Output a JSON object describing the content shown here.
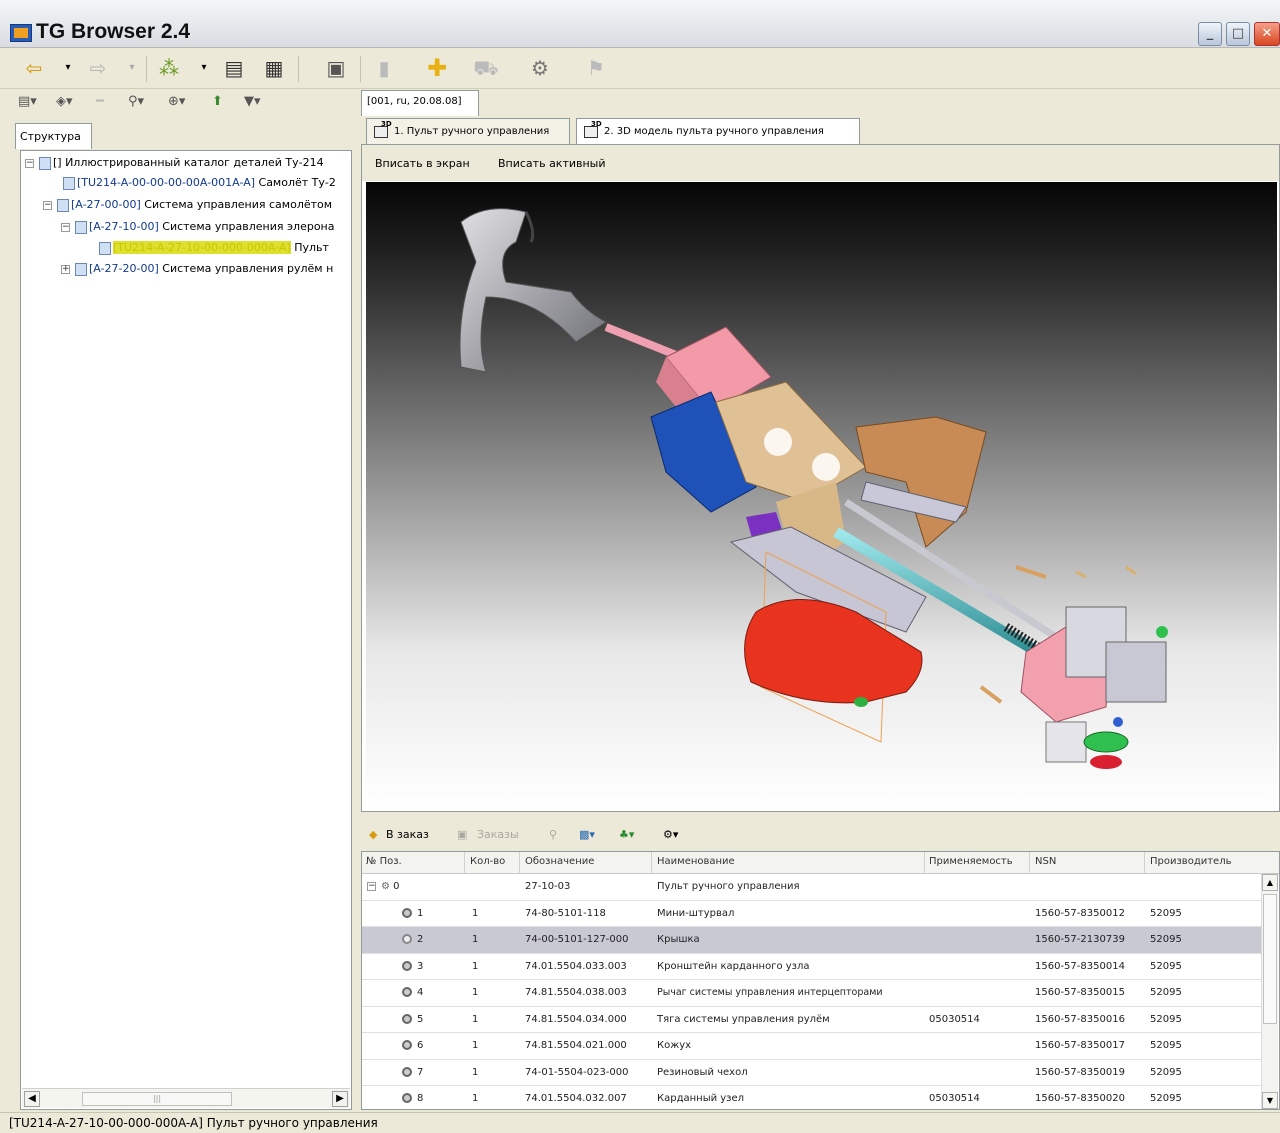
{
  "window": {
    "title": "TG Browser 2.4",
    "min_label": "_",
    "max_label": "□",
    "close_label": "✕"
  },
  "left": {
    "tab_label": "Структура",
    "tree": [
      {
        "code": "",
        "text": "[] Иллюстрированный каталог деталей Ту-214"
      },
      {
        "code": "[TU214-A-00-00-00-00A-001A-A]",
        "text": " Самолёт Ту-2"
      },
      {
        "code": "[A-27-00-00]",
        "text": " Система управления самолётом"
      },
      {
        "code": "[A-27-10-00]",
        "text": " Система управления элерона"
      },
      {
        "code": "[TU214-A-27-10-00-000-000A-A]",
        "text": " Пульт"
      },
      {
        "code": "[A-27-20-00]",
        "text": " Система управления рулём н"
      }
    ]
  },
  "doc_tab": "[001, ru, 20.08.08]",
  "view_tabs": [
    "1. Пульт ручного управления",
    "2. 3D модель пульта ручного управления"
  ],
  "fit_bar": {
    "fit_screen": "Вписать в экран",
    "fit_active": "Вписать активный"
  },
  "bottom_toolbar": {
    "add_to_order": "В заказ",
    "orders": "Заказы"
  },
  "grid": {
    "headers": [
      "№ Поз.",
      "Кол-во",
      "Обозначение",
      "Наименование",
      "Применяемость",
      "NSN",
      "Производитель"
    ],
    "rows": [
      {
        "pos": "0",
        "qty": "",
        "designation": "27-10-03",
        "name": "Пульт ручного управления",
        "applicability": "",
        "nsn": "",
        "manufacturer": ""
      },
      {
        "pos": "1",
        "qty": "1",
        "designation": "74-80-5101-118",
        "name": "Мини-штурвал",
        "applicability": "",
        "nsn": "1560-57-8350012",
        "manufacturer": "52095"
      },
      {
        "pos": "2",
        "qty": "1",
        "designation": "74-00-5101-127-000",
        "name": "Крышка",
        "applicability": "",
        "nsn": "1560-57-2130739",
        "manufacturer": "52095"
      },
      {
        "pos": "3",
        "qty": "1",
        "designation": "74.01.5504.033.003",
        "name": "Кронштейн карданного узла",
        "applicability": "",
        "nsn": "1560-57-8350014",
        "manufacturer": "52095"
      },
      {
        "pos": "4",
        "qty": "1",
        "designation": "74.81.5504.038.003",
        "name": "Рычаг системы управления интерцепторами",
        "applicability": "",
        "nsn": "1560-57-8350015",
        "manufacturer": "52095"
      },
      {
        "pos": "5",
        "qty": "1",
        "designation": "74.81.5504.034.000",
        "name": "Тяга системы управления рулём",
        "applicability": "05030514",
        "nsn": "1560-57-8350016",
        "manufacturer": "52095"
      },
      {
        "pos": "6",
        "qty": "1",
        "designation": "74.81.5504.021.000",
        "name": "Кожух",
        "applicability": "",
        "nsn": "1560-57-8350017",
        "manufacturer": "52095"
      },
      {
        "pos": "7",
        "qty": "1",
        "designation": "74-01-5504-023-000",
        "name": "Резиновый чехол",
        "applicability": "",
        "nsn": "1560-57-8350019",
        "manufacturer": "52095"
      },
      {
        "pos": "8",
        "qty": "1",
        "designation": "74.01.5504.032.007",
        "name": "Карданный узел",
        "applicability": "05030514",
        "nsn": "1560-57-8350020",
        "manufacturer": "52095"
      }
    ],
    "selected_row": 2
  },
  "status": "[TU214-A-27-10-00-000-000A-A] Пульт ручного управления",
  "colors": {
    "selection": "#c9c9d4",
    "tree_highlight": "#dfdf30",
    "window_bg": "#ece9d8"
  }
}
